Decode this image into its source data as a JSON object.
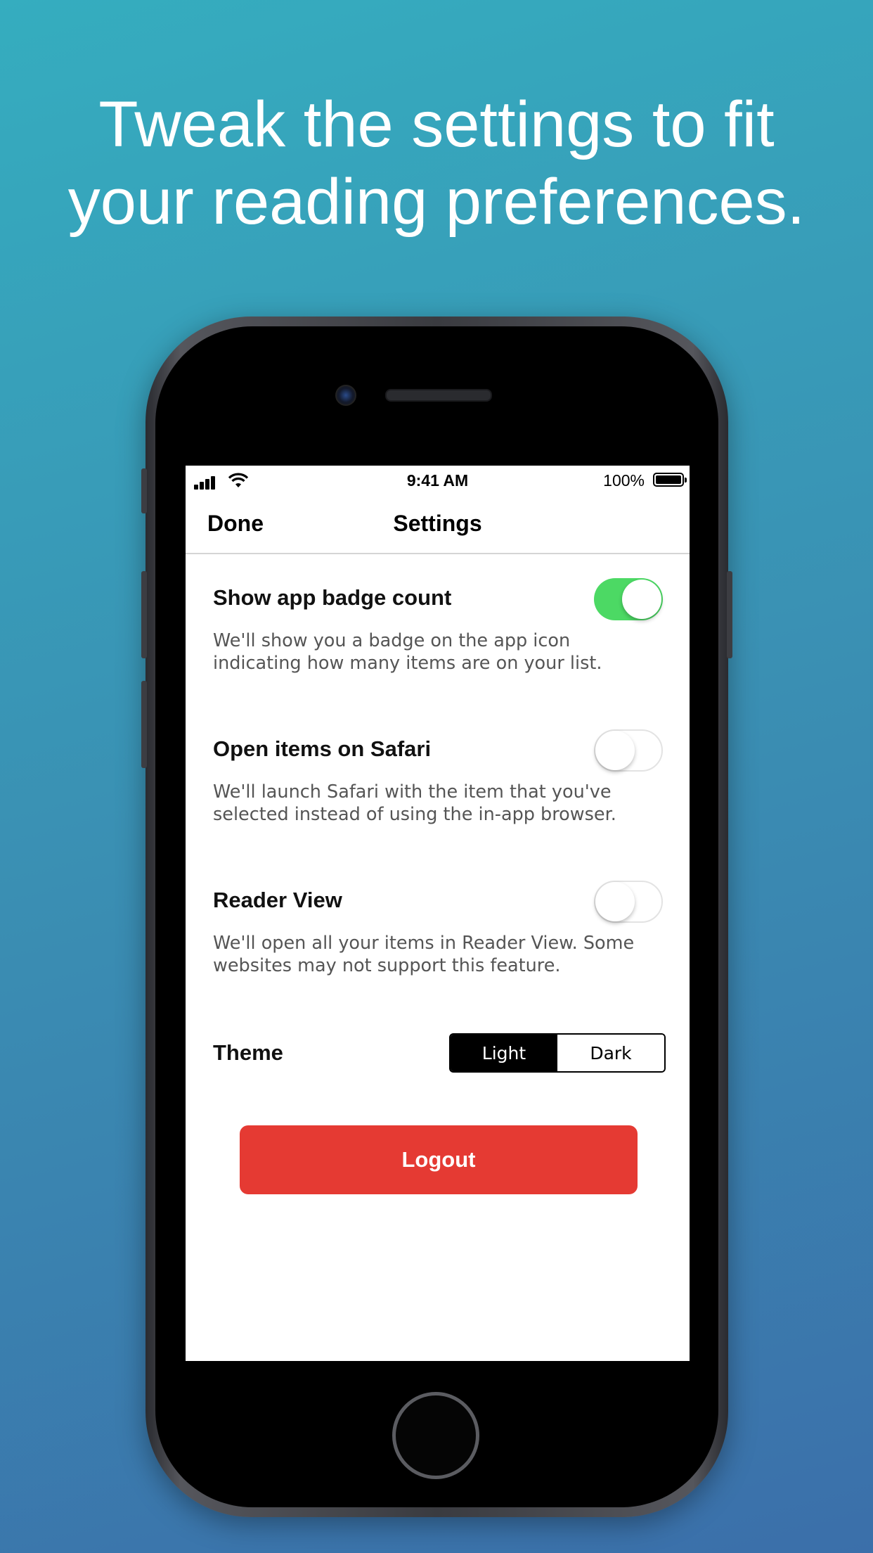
{
  "headline": {
    "line1": "Tweak the settings to fit",
    "line2": "your reading preferences."
  },
  "status_bar": {
    "time": "9:41 AM",
    "battery_percent": "100%"
  },
  "nav": {
    "done_label": "Done",
    "title": "Settings"
  },
  "settings": [
    {
      "label": "Show app badge count",
      "description": "We'll show you a badge on the app icon indicating how many items are on your list.",
      "enabled": true
    },
    {
      "label": "Open items on Safari",
      "description": "We'll launch Safari with the item that you've selected instead of using the in-app browser.",
      "enabled": false
    },
    {
      "label": "Reader View",
      "description": "We'll open all your items in Reader View. Some websites may not support this feature.",
      "enabled": false
    }
  ],
  "theme": {
    "label": "Theme",
    "options": [
      "Light",
      "Dark"
    ],
    "selected": "Light"
  },
  "logout_label": "Logout",
  "colors": {
    "toggle_on": "#4cd964",
    "logout": "#e53a33",
    "background_top": "#35adbf",
    "background_bottom": "#3b6faa"
  }
}
